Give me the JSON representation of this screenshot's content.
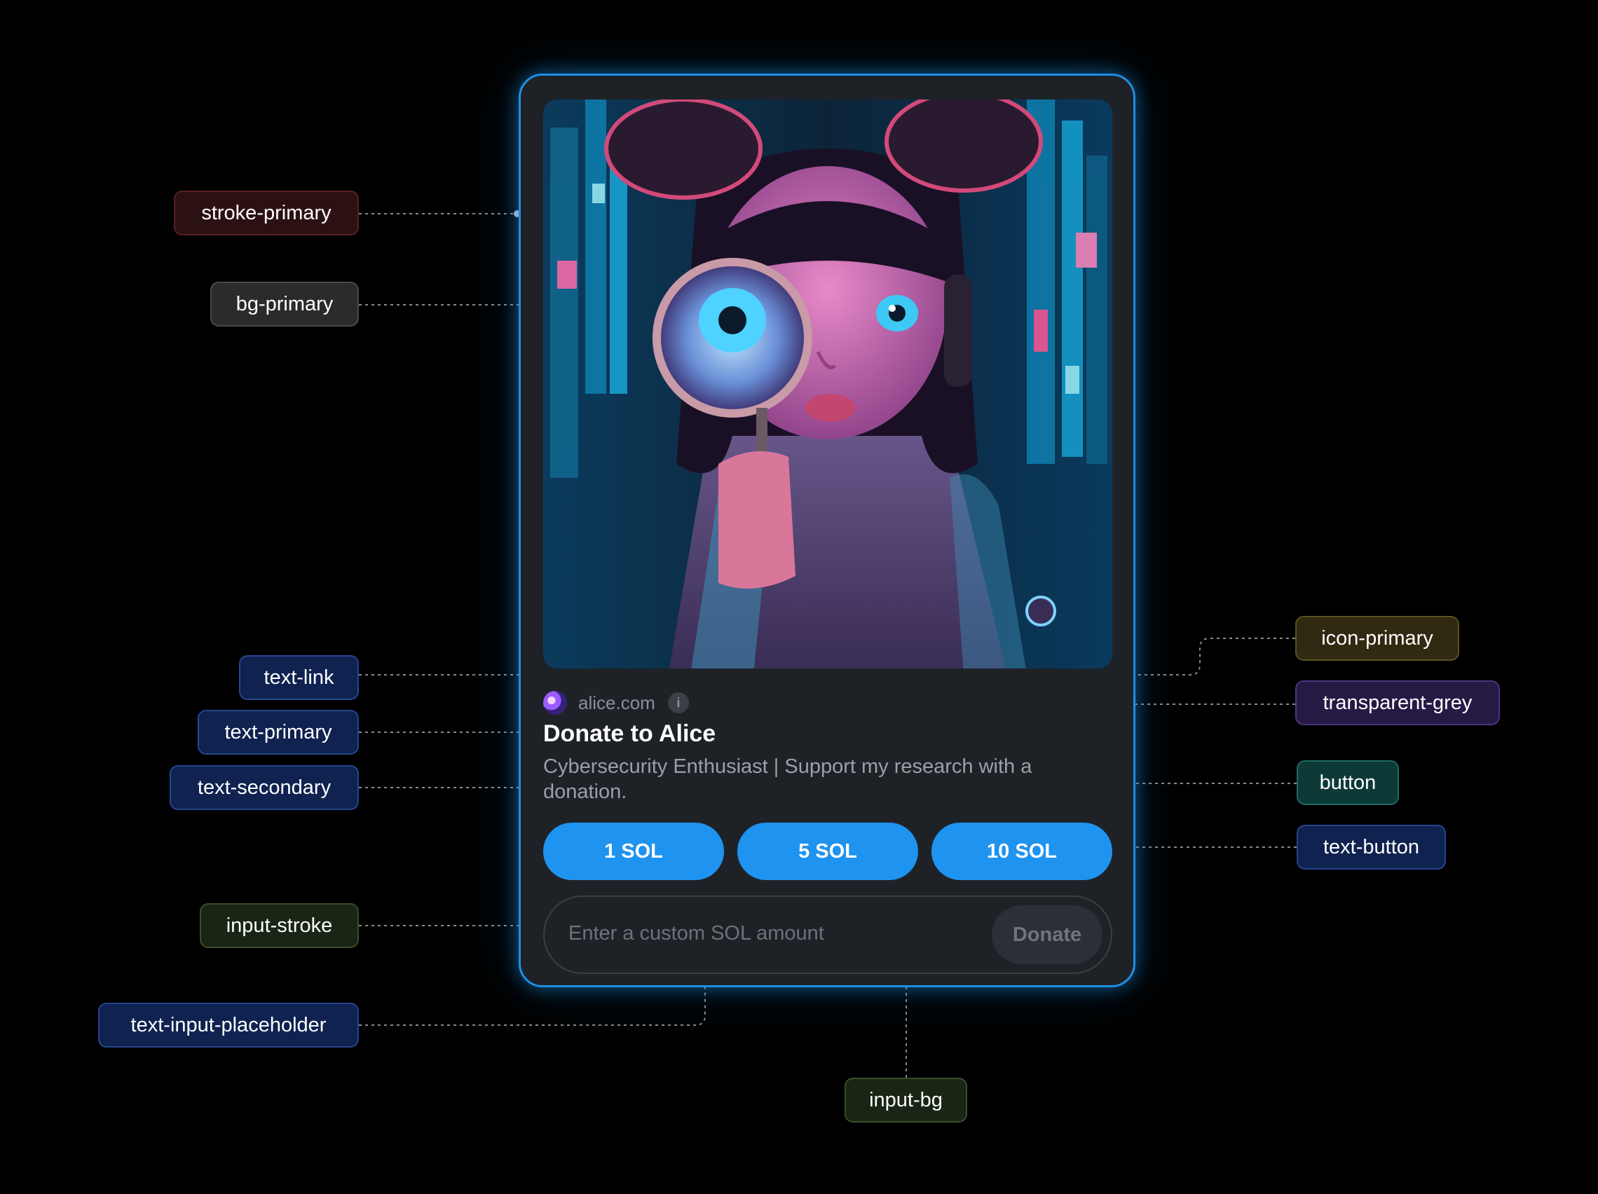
{
  "card": {
    "site_link": "alice.com",
    "title": "Donate to Alice",
    "description": "Cybersecurity Enthusiast | Support my research with a donation.",
    "amount_buttons": [
      "1 SOL",
      "5 SOL",
      "10 SOL"
    ],
    "input_placeholder": "Enter a custom SOL amount",
    "donate_label": "Donate",
    "image": "cyberpunk girl holding magnifying glass"
  },
  "labels": {
    "stroke_primary": "stroke-primary",
    "bg_primary": "bg-primary",
    "text_link": "text-link",
    "text_primary": "text-primary",
    "text_secondary": "text-secondary",
    "input_stroke": "input-stroke",
    "text_input_placeholder": "text-input-placeholder",
    "input_bg": "input-bg",
    "icon_primary": "icon-primary",
    "transparent_grey": "transparent-grey",
    "button": "button",
    "text_button": "text-button"
  },
  "colors": {
    "background": "#000000",
    "stroke_primary": "#1d8fe6",
    "bg_primary": "#1e2227",
    "button": "#1e93f0",
    "text_primary": "#ffffff",
    "text_secondary": "#9aa0a8",
    "input_stroke": "#3a3f46"
  },
  "icons": [
    "site-favicon-icon",
    "info-icon"
  ]
}
